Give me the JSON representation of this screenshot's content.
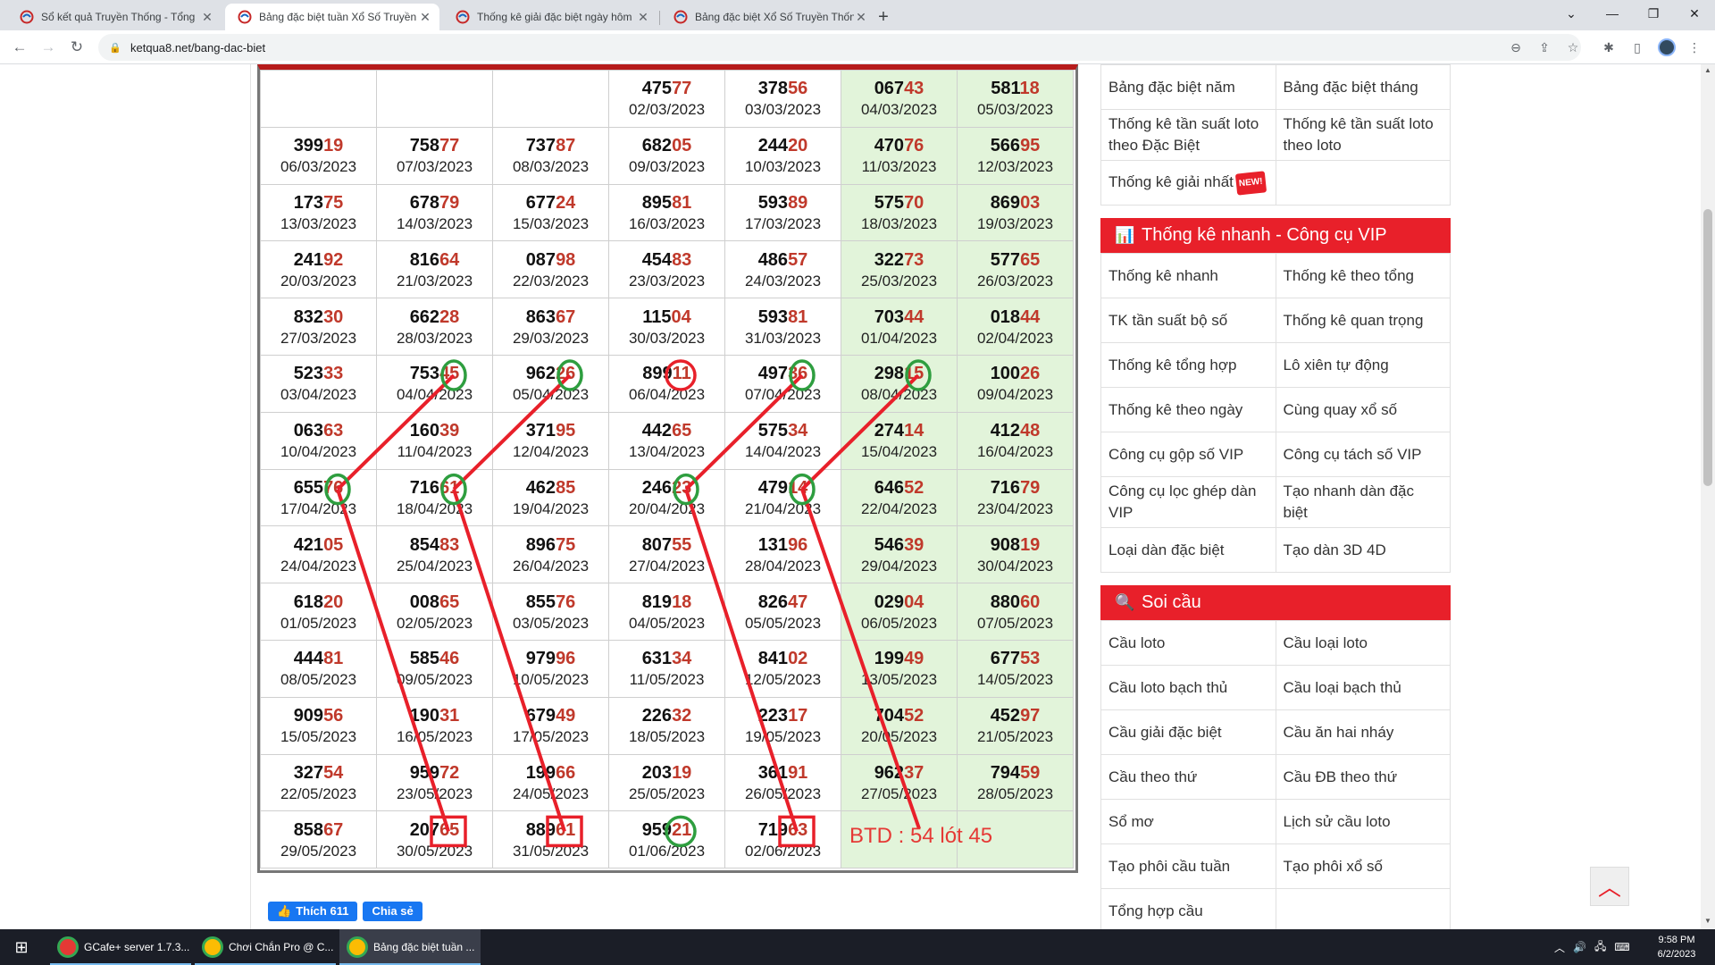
{
  "browser": {
    "tabs": [
      {
        "title": "Sổ kết quả Truyền Thống - Tổng",
        "active": false
      },
      {
        "title": "Bảng đặc biệt tuần Xổ Số Truyền",
        "active": true
      },
      {
        "title": "Thống kê giải đặc biệt ngày hôm",
        "active": false
      },
      {
        "title": "Bảng đặc biệt Xổ Số Truyền Thốn",
        "active": false
      }
    ],
    "new_tab_label": "+",
    "url": "ketqua8.net/bang-dac-biet"
  },
  "colors": {
    "accent_red": "#e8202a",
    "weekend_green": "#e2f4da",
    "tail_red": "#c0392b",
    "circle_green": "#2e9e3f"
  },
  "results_table": {
    "rows": [
      [
        {
          "n": "",
          "d": ""
        },
        {
          "n": "",
          "d": ""
        },
        {
          "n": "",
          "d": ""
        },
        {
          "n": "47577",
          "d": "02/03/2023"
        },
        {
          "n": "37856",
          "d": "03/03/2023"
        },
        {
          "n": "06743",
          "d": "04/03/2023"
        },
        {
          "n": "58118",
          "d": "05/03/2023"
        }
      ],
      [
        {
          "n": "39919",
          "d": "06/03/2023"
        },
        {
          "n": "75877",
          "d": "07/03/2023"
        },
        {
          "n": "73787",
          "d": "08/03/2023"
        },
        {
          "n": "68205",
          "d": "09/03/2023"
        },
        {
          "n": "24420",
          "d": "10/03/2023"
        },
        {
          "n": "47076",
          "d": "11/03/2023"
        },
        {
          "n": "56695",
          "d": "12/03/2023"
        }
      ],
      [
        {
          "n": "17375",
          "d": "13/03/2023"
        },
        {
          "n": "67879",
          "d": "14/03/2023"
        },
        {
          "n": "67724",
          "d": "15/03/2023"
        },
        {
          "n": "89581",
          "d": "16/03/2023"
        },
        {
          "n": "59389",
          "d": "17/03/2023"
        },
        {
          "n": "57570",
          "d": "18/03/2023"
        },
        {
          "n": "86903",
          "d": "19/03/2023"
        }
      ],
      [
        {
          "n": "24192",
          "d": "20/03/2023"
        },
        {
          "n": "81664",
          "d": "21/03/2023"
        },
        {
          "n": "08798",
          "d": "22/03/2023"
        },
        {
          "n": "45483",
          "d": "23/03/2023"
        },
        {
          "n": "48657",
          "d": "24/03/2023"
        },
        {
          "n": "32273",
          "d": "25/03/2023"
        },
        {
          "n": "57765",
          "d": "26/03/2023"
        }
      ],
      [
        {
          "n": "83230",
          "d": "27/03/2023"
        },
        {
          "n": "66228",
          "d": "28/03/2023"
        },
        {
          "n": "86367",
          "d": "29/03/2023"
        },
        {
          "n": "11504",
          "d": "30/03/2023"
        },
        {
          "n": "59381",
          "d": "31/03/2023"
        },
        {
          "n": "70344",
          "d": "01/04/2023"
        },
        {
          "n": "01844",
          "d": "02/04/2023"
        }
      ],
      [
        {
          "n": "52333",
          "d": "03/04/2023"
        },
        {
          "n": "75345",
          "d": "04/04/2023"
        },
        {
          "n": "96226",
          "d": "05/04/2023"
        },
        {
          "n": "89911",
          "d": "06/04/2023"
        },
        {
          "n": "49736",
          "d": "07/04/2023"
        },
        {
          "n": "29815",
          "d": "08/04/2023"
        },
        {
          "n": "10026",
          "d": "09/04/2023"
        }
      ],
      [
        {
          "n": "06363",
          "d": "10/04/2023"
        },
        {
          "n": "16039",
          "d": "11/04/2023"
        },
        {
          "n": "37195",
          "d": "12/04/2023"
        },
        {
          "n": "44265",
          "d": "13/04/2023"
        },
        {
          "n": "57534",
          "d": "14/04/2023"
        },
        {
          "n": "27414",
          "d": "15/04/2023"
        },
        {
          "n": "41248",
          "d": "16/04/2023"
        }
      ],
      [
        {
          "n": "65576",
          "d": "17/04/2023"
        },
        {
          "n": "71661",
          "d": "18/04/2023"
        },
        {
          "n": "46285",
          "d": "19/04/2023"
        },
        {
          "n": "24623",
          "d": "20/04/2023"
        },
        {
          "n": "47914",
          "d": "21/04/2023"
        },
        {
          "n": "64652",
          "d": "22/04/2023"
        },
        {
          "n": "71679",
          "d": "23/04/2023"
        }
      ],
      [
        {
          "n": "42105",
          "d": "24/04/2023"
        },
        {
          "n": "85483",
          "d": "25/04/2023"
        },
        {
          "n": "89675",
          "d": "26/04/2023"
        },
        {
          "n": "80755",
          "d": "27/04/2023"
        },
        {
          "n": "13196",
          "d": "28/04/2023"
        },
        {
          "n": "54639",
          "d": "29/04/2023"
        },
        {
          "n": "90819",
          "d": "30/04/2023"
        }
      ],
      [
        {
          "n": "61820",
          "d": "01/05/2023"
        },
        {
          "n": "00865",
          "d": "02/05/2023"
        },
        {
          "n": "85576",
          "d": "03/05/2023"
        },
        {
          "n": "81918",
          "d": "04/05/2023"
        },
        {
          "n": "82647",
          "d": "05/05/2023"
        },
        {
          "n": "02904",
          "d": "06/05/2023"
        },
        {
          "n": "88060",
          "d": "07/05/2023"
        }
      ],
      [
        {
          "n": "44481",
          "d": "08/05/2023"
        },
        {
          "n": "58546",
          "d": "09/05/2023"
        },
        {
          "n": "97996",
          "d": "10/05/2023"
        },
        {
          "n": "63134",
          "d": "11/05/2023"
        },
        {
          "n": "84102",
          "d": "12/05/2023"
        },
        {
          "n": "19949",
          "d": "13/05/2023"
        },
        {
          "n": "67753",
          "d": "14/05/2023"
        }
      ],
      [
        {
          "n": "90956",
          "d": "15/05/2023"
        },
        {
          "n": "19031",
          "d": "16/05/2023"
        },
        {
          "n": "67949",
          "d": "17/05/2023"
        },
        {
          "n": "22632",
          "d": "18/05/2023"
        },
        {
          "n": "22317",
          "d": "19/05/2023"
        },
        {
          "n": "70452",
          "d": "20/05/2023"
        },
        {
          "n": "45297",
          "d": "21/05/2023"
        }
      ],
      [
        {
          "n": "32754",
          "d": "22/05/2023"
        },
        {
          "n": "95972",
          "d": "23/05/2023"
        },
        {
          "n": "19966",
          "d": "24/05/2023"
        },
        {
          "n": "20319",
          "d": "25/05/2023"
        },
        {
          "n": "36191",
          "d": "26/05/2023"
        },
        {
          "n": "96237",
          "d": "27/05/2023"
        },
        {
          "n": "79459",
          "d": "28/05/2023"
        }
      ],
      [
        {
          "n": "85867",
          "d": "29/05/2023"
        },
        {
          "n": "20765",
          "d": "30/05/2023"
        },
        {
          "n": "88961",
          "d": "31/05/2023"
        },
        {
          "n": "95921",
          "d": "01/06/2023"
        },
        {
          "n": "71963",
          "d": "02/06/2023"
        },
        {
          "n": "",
          "d": ""
        },
        {
          "n": "",
          "d": ""
        }
      ]
    ]
  },
  "annotation": {
    "text": "BTD : 54 lót 45"
  },
  "social": {
    "like_label": "Thích 611",
    "share_label": "Chia sẻ"
  },
  "sidebar": {
    "top_links": [
      [
        "Bảng đặc biệt năm",
        "Bảng đặc biệt tháng"
      ],
      [
        "Thống kê tần suất loto theo Đặc Biệt",
        "Thống kê tần suất loto theo loto"
      ],
      [
        "Thống kê giải nhất",
        ""
      ]
    ],
    "new_badge": "NEW!",
    "quick_title": "Thống kê nhanh - Công cụ VIP",
    "quick_links": [
      [
        "Thống kê nhanh",
        "Thống kê theo tổng"
      ],
      [
        "TK tần suất bộ số",
        "Thống kê quan trọng"
      ],
      [
        "Thống kê tổng hợp",
        "Lô xiên tự động"
      ],
      [
        "Thống kê theo ngày",
        "Cùng quay xổ số"
      ],
      [
        "Công cụ gộp số VIP",
        "Công cụ tách số VIP"
      ],
      [
        "Công cụ lọc ghép dàn VIP",
        "Tạo nhanh dàn đặc biệt"
      ],
      [
        "Loại dàn đặc biệt",
        "Tạo dàn 3D 4D"
      ]
    ],
    "soi_title": "Soi cầu",
    "soi_links": [
      [
        "Cầu loto",
        "Cầu loại loto"
      ],
      [
        "Cầu loto bạch thủ",
        "Cầu loại bạch thủ"
      ],
      [
        "Cầu giải đặc biệt",
        "Cầu ăn hai nháy"
      ],
      [
        "Cầu theo thứ",
        "Cầu ĐB theo thứ"
      ],
      [
        "Sổ mơ",
        "Lịch sử cầu loto"
      ],
      [
        "Tạo phôi cầu tuần",
        "Tạo phôi xổ số"
      ],
      [
        "Tổng hợp cầu",
        ""
      ]
    ]
  },
  "taskbar": {
    "items": [
      {
        "label": "GCafe+ server 1.7.3...",
        "icon": "gcafe-icon",
        "color": "#e53935"
      },
      {
        "label": "Chơi Chắn Pro @ C...",
        "icon": "chrome-icon",
        "color": "#fbbc04"
      },
      {
        "label": "Bảng đặc biệt tuần ...",
        "icon": "chrome-icon",
        "color": "#fbbc04"
      }
    ],
    "time": "9:58 PM",
    "date": "6/2/2023"
  }
}
